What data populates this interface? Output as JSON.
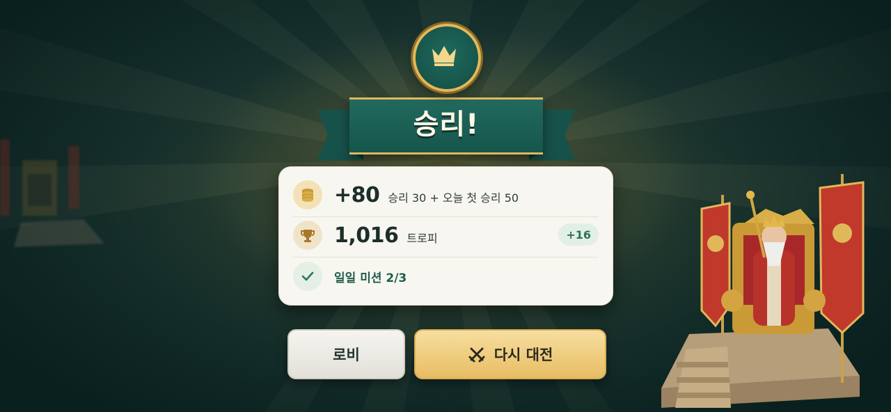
{
  "title": "승리!",
  "rewards": {
    "coins": {
      "icon": "coin-stack-icon",
      "amount": "+80",
      "detail": "승리 30 + 오늘 첫 승리 50"
    },
    "trophies": {
      "icon": "trophy-icon",
      "amount": "1,016",
      "label": "트로피",
      "delta": "+16"
    },
    "mission": {
      "icon": "check-icon",
      "text": "일일 미션 2/3"
    }
  },
  "buttons": {
    "lobby": "로비",
    "rematch": "다시 대전",
    "rematch_icon": "crossed-swords-icon"
  },
  "colors": {
    "accent_gold": "#e2b85a",
    "banner_green": "#1b6055",
    "rematch_button": "#e9c26c",
    "positive_green": "#2a7556"
  }
}
